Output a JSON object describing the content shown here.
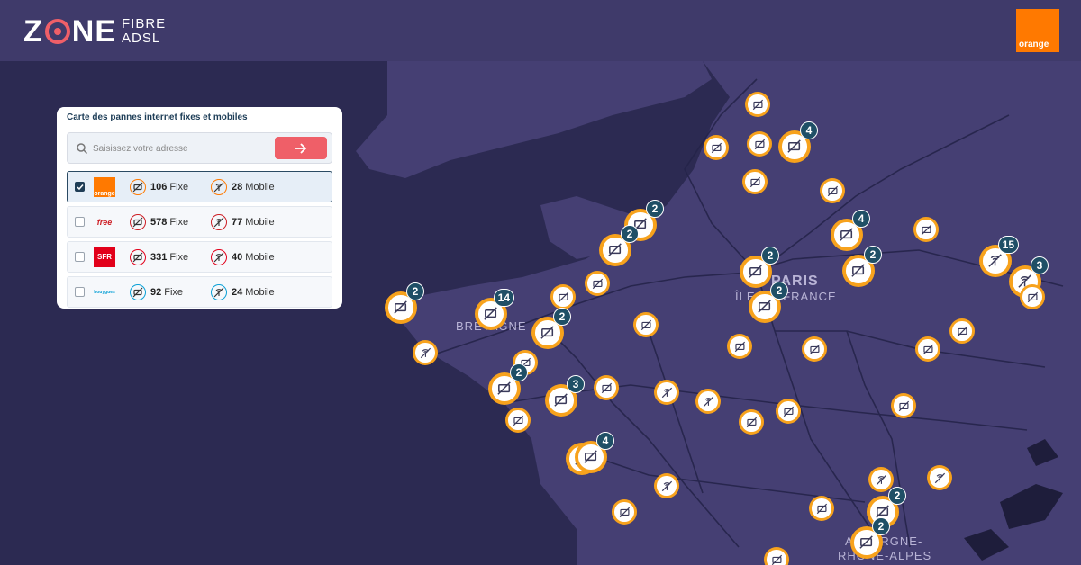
{
  "header": {
    "logo_word": "Z NE",
    "logo_line1": "FIBRE",
    "logo_line2": "ADSL",
    "brand": "orange"
  },
  "panel": {
    "title": "Carte des pannes internet fixes et mobiles",
    "search_placeholder": "Saisissez votre adresse",
    "operators": [
      {
        "name": "orange",
        "logo_text": "orange",
        "checked": true,
        "fixe_count": "106",
        "fixe_label": "Fixe",
        "mobile_count": "28",
        "mobile_label": "Mobile",
        "color": "#ff7900"
      },
      {
        "name": "free",
        "logo_text": "free",
        "checked": false,
        "fixe_count": "578",
        "fixe_label": "Fixe",
        "mobile_count": "77",
        "mobile_label": "Mobile",
        "color": "#cd1e25"
      },
      {
        "name": "sfr",
        "logo_text": "SFR",
        "checked": false,
        "fixe_count": "331",
        "fixe_label": "Fixe",
        "mobile_count": "40",
        "mobile_label": "Mobile",
        "color": "#e2001a"
      },
      {
        "name": "bouygues",
        "logo_text": "bouygues",
        "checked": false,
        "fixe_count": "92",
        "fixe_label": "Fixe",
        "mobile_count": "24",
        "mobile_label": "Mobile",
        "color": "#0aa0d6"
      }
    ]
  },
  "map": {
    "labels": [
      "PARIS",
      "ÎLE-DE-FRANCE",
      "BRETAGNE",
      "AUVERGNE-",
      "RHÔNE-ALPES"
    ],
    "cluster_counts": [
      "4",
      "2",
      "2",
      "4",
      "2",
      "15",
      "3",
      "2",
      "2",
      "14",
      "2",
      "2",
      "2",
      "3",
      "4",
      "2",
      "2"
    ]
  },
  "colors": {
    "header": "#3f3a6a",
    "map_bg": "#2c2a52",
    "land": "#453f73",
    "marker": "#f7a21c",
    "badge": "#1f4f66",
    "accent": "#ef5f68"
  }
}
